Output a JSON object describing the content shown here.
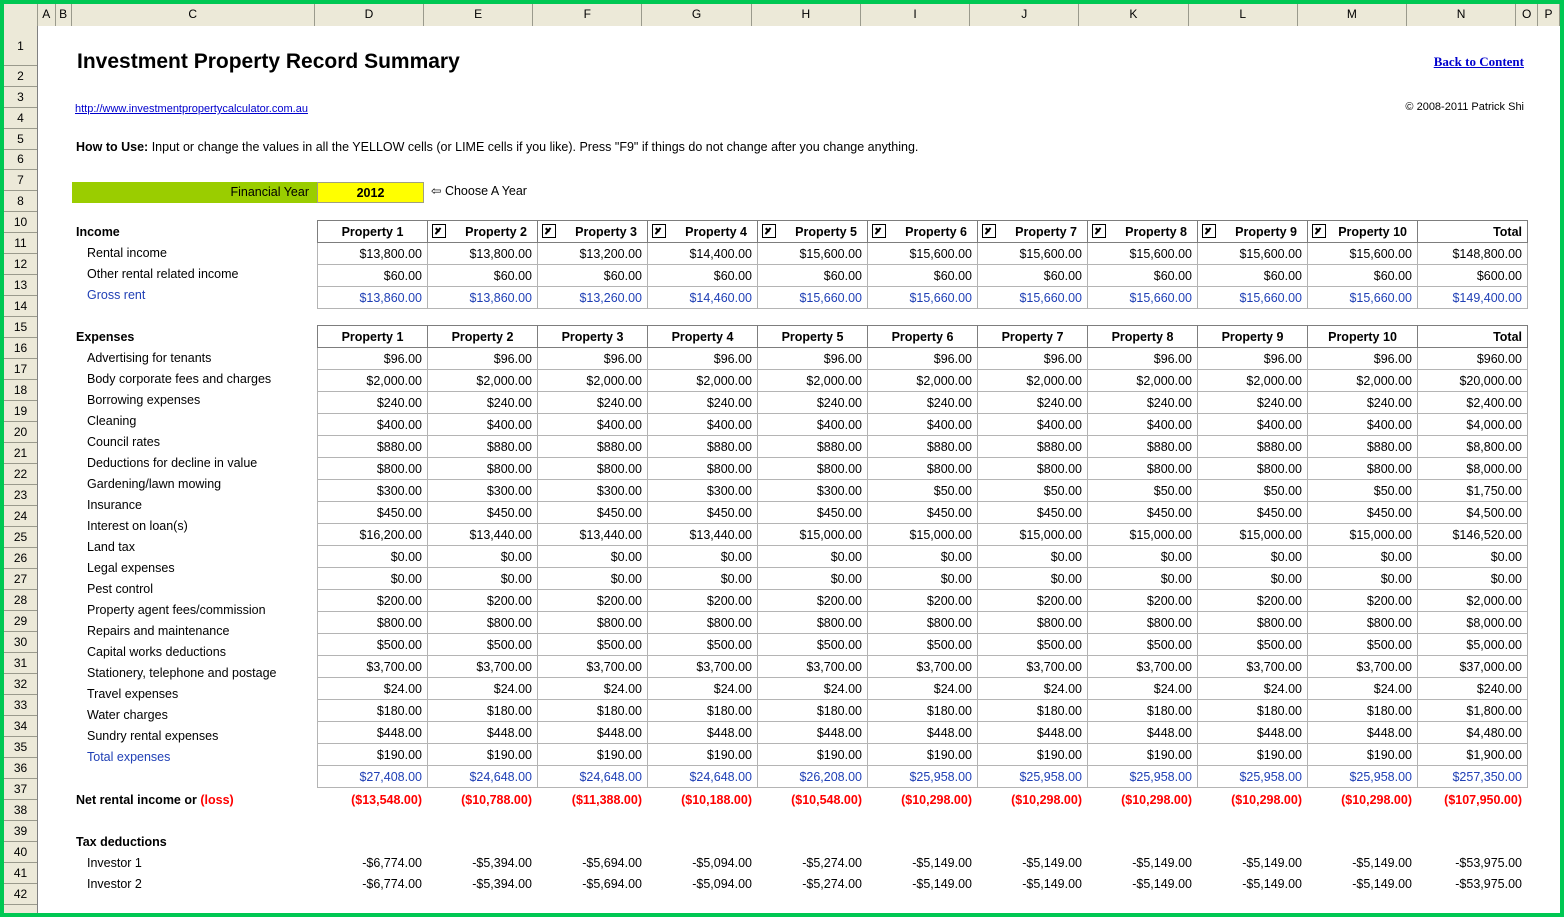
{
  "spreadsheet": {
    "column_headers": [
      "A",
      "B",
      "C",
      "D",
      "E",
      "F",
      "G",
      "H",
      "I",
      "J",
      "K",
      "L",
      "M",
      "N",
      "O",
      "P"
    ],
    "row_headers": [
      "1",
      "2",
      "3",
      "4",
      "5",
      "6",
      "7",
      "8",
      "10",
      "11",
      "12",
      "13",
      "14",
      "15",
      "16",
      "17",
      "18",
      "19",
      "20",
      "21",
      "22",
      "23",
      "24",
      "25",
      "26",
      "27",
      "28",
      "29",
      "30",
      "31",
      "32",
      "33",
      "34",
      "35",
      "36",
      "37",
      "38",
      "39",
      "40",
      "41",
      "42"
    ],
    "colors": {
      "selection_border": "#00c853",
      "header_bg": "#ece9d8",
      "lime": "#9acd00",
      "yellow": "#ffff00",
      "blue_text": "#1f3fb5",
      "link": "#0000cd",
      "red": "#ff0000"
    }
  },
  "header": {
    "title": "Investment Property Record Summary",
    "website_url": "http://www.investmentpropertycalculator.com.au",
    "back_to_content": "Back to Content",
    "copyright": "© 2008-2011 Patrick Shi",
    "howto_label": "How to Use:",
    "howto_text": " Input or change the values in all the YELLOW cells (or LIME cells if you like). Press \"F9\" if things do not change after you change anything.",
    "financial_year_label": "Financial Year",
    "financial_year_value": "2012",
    "choose_a_year": "⇦ Choose A Year"
  },
  "income": {
    "section_title": "Income",
    "columns": [
      "Property 1",
      "Property 2",
      "Property 3",
      "Property 4",
      "Property 5",
      "Property 6",
      "Property 7",
      "Property 8",
      "Property 9",
      "Property 10",
      "Total"
    ],
    "checkboxes": [
      false,
      true,
      true,
      true,
      true,
      true,
      true,
      true,
      true,
      true,
      false
    ],
    "rows": [
      {
        "label": "Rental income",
        "blue": false,
        "values": [
          "$13,800.00",
          "$13,800.00",
          "$13,200.00",
          "$14,400.00",
          "$15,600.00",
          "$15,600.00",
          "$15,600.00",
          "$15,600.00",
          "$15,600.00",
          "$15,600.00",
          "$148,800.00"
        ]
      },
      {
        "label": "Other rental related income",
        "blue": false,
        "values": [
          "$60.00",
          "$60.00",
          "$60.00",
          "$60.00",
          "$60.00",
          "$60.00",
          "$60.00",
          "$60.00",
          "$60.00",
          "$60.00",
          "$600.00"
        ]
      },
      {
        "label": "Gross rent",
        "blue": true,
        "values": [
          "$13,860.00",
          "$13,860.00",
          "$13,260.00",
          "$14,460.00",
          "$15,660.00",
          "$15,660.00",
          "$15,660.00",
          "$15,660.00",
          "$15,660.00",
          "$15,660.00",
          "$149,400.00"
        ]
      }
    ]
  },
  "expenses": {
    "section_title": "Expenses",
    "columns": [
      "Property 1",
      "Property 2",
      "Property 3",
      "Property 4",
      "Property 5",
      "Property 6",
      "Property 7",
      "Property 8",
      "Property 9",
      "Property 10",
      "Total"
    ],
    "rows": [
      {
        "label": "Advertising for tenants",
        "blue": false,
        "values": [
          "$96.00",
          "$96.00",
          "$96.00",
          "$96.00",
          "$96.00",
          "$96.00",
          "$96.00",
          "$96.00",
          "$96.00",
          "$96.00",
          "$960.00"
        ]
      },
      {
        "label": "Body corporate fees and charges",
        "blue": false,
        "values": [
          "$2,000.00",
          "$2,000.00",
          "$2,000.00",
          "$2,000.00",
          "$2,000.00",
          "$2,000.00",
          "$2,000.00",
          "$2,000.00",
          "$2,000.00",
          "$2,000.00",
          "$20,000.00"
        ]
      },
      {
        "label": "Borrowing expenses",
        "blue": false,
        "values": [
          "$240.00",
          "$240.00",
          "$240.00",
          "$240.00",
          "$240.00",
          "$240.00",
          "$240.00",
          "$240.00",
          "$240.00",
          "$240.00",
          "$2,400.00"
        ]
      },
      {
        "label": "Cleaning",
        "blue": false,
        "values": [
          "$400.00",
          "$400.00",
          "$400.00",
          "$400.00",
          "$400.00",
          "$400.00",
          "$400.00",
          "$400.00",
          "$400.00",
          "$400.00",
          "$4,000.00"
        ]
      },
      {
        "label": "Council rates",
        "blue": false,
        "values": [
          "$880.00",
          "$880.00",
          "$880.00",
          "$880.00",
          "$880.00",
          "$880.00",
          "$880.00",
          "$880.00",
          "$880.00",
          "$880.00",
          "$8,800.00"
        ]
      },
      {
        "label": "Deductions for decline in value",
        "blue": false,
        "values": [
          "$800.00",
          "$800.00",
          "$800.00",
          "$800.00",
          "$800.00",
          "$800.00",
          "$800.00",
          "$800.00",
          "$800.00",
          "$800.00",
          "$8,000.00"
        ]
      },
      {
        "label": "Gardening/lawn mowing",
        "blue": false,
        "values": [
          "$300.00",
          "$300.00",
          "$300.00",
          "$300.00",
          "$300.00",
          "$50.00",
          "$50.00",
          "$50.00",
          "$50.00",
          "$50.00",
          "$1,750.00"
        ]
      },
      {
        "label": "Insurance",
        "blue": false,
        "values": [
          "$450.00",
          "$450.00",
          "$450.00",
          "$450.00",
          "$450.00",
          "$450.00",
          "$450.00",
          "$450.00",
          "$450.00",
          "$450.00",
          "$4,500.00"
        ]
      },
      {
        "label": "Interest on loan(s)",
        "blue": false,
        "values": [
          "$16,200.00",
          "$13,440.00",
          "$13,440.00",
          "$13,440.00",
          "$15,000.00",
          "$15,000.00",
          "$15,000.00",
          "$15,000.00",
          "$15,000.00",
          "$15,000.00",
          "$146,520.00"
        ]
      },
      {
        "label": "Land tax",
        "blue": false,
        "values": [
          "$0.00",
          "$0.00",
          "$0.00",
          "$0.00",
          "$0.00",
          "$0.00",
          "$0.00",
          "$0.00",
          "$0.00",
          "$0.00",
          "$0.00"
        ]
      },
      {
        "label": "Legal expenses",
        "blue": false,
        "values": [
          "$0.00",
          "$0.00",
          "$0.00",
          "$0.00",
          "$0.00",
          "$0.00",
          "$0.00",
          "$0.00",
          "$0.00",
          "$0.00",
          "$0.00"
        ]
      },
      {
        "label": "Pest control",
        "blue": false,
        "values": [
          "$200.00",
          "$200.00",
          "$200.00",
          "$200.00",
          "$200.00",
          "$200.00",
          "$200.00",
          "$200.00",
          "$200.00",
          "$200.00",
          "$2,000.00"
        ]
      },
      {
        "label": "Property agent fees/commission",
        "blue": false,
        "values": [
          "$800.00",
          "$800.00",
          "$800.00",
          "$800.00",
          "$800.00",
          "$800.00",
          "$800.00",
          "$800.00",
          "$800.00",
          "$800.00",
          "$8,000.00"
        ]
      },
      {
        "label": "Repairs and maintenance",
        "blue": false,
        "values": [
          "$500.00",
          "$500.00",
          "$500.00",
          "$500.00",
          "$500.00",
          "$500.00",
          "$500.00",
          "$500.00",
          "$500.00",
          "$500.00",
          "$5,000.00"
        ]
      },
      {
        "label": "Capital works deductions",
        "blue": false,
        "values": [
          "$3,700.00",
          "$3,700.00",
          "$3,700.00",
          "$3,700.00",
          "$3,700.00",
          "$3,700.00",
          "$3,700.00",
          "$3,700.00",
          "$3,700.00",
          "$3,700.00",
          "$37,000.00"
        ]
      },
      {
        "label": "Stationery, telephone and postage",
        "blue": false,
        "values": [
          "$24.00",
          "$24.00",
          "$24.00",
          "$24.00",
          "$24.00",
          "$24.00",
          "$24.00",
          "$24.00",
          "$24.00",
          "$24.00",
          "$240.00"
        ]
      },
      {
        "label": "Travel expenses",
        "blue": false,
        "values": [
          "$180.00",
          "$180.00",
          "$180.00",
          "$180.00",
          "$180.00",
          "$180.00",
          "$180.00",
          "$180.00",
          "$180.00",
          "$180.00",
          "$1,800.00"
        ]
      },
      {
        "label": "Water charges",
        "blue": false,
        "values": [
          "$448.00",
          "$448.00",
          "$448.00",
          "$448.00",
          "$448.00",
          "$448.00",
          "$448.00",
          "$448.00",
          "$448.00",
          "$448.00",
          "$4,480.00"
        ]
      },
      {
        "label": "Sundry rental expenses",
        "blue": false,
        "values": [
          "$190.00",
          "$190.00",
          "$190.00",
          "$190.00",
          "$190.00",
          "$190.00",
          "$190.00",
          "$190.00",
          "$190.00",
          "$190.00",
          "$1,900.00"
        ]
      },
      {
        "label": "Total expenses",
        "blue": true,
        "values": [
          "$27,408.00",
          "$24,648.00",
          "$24,648.00",
          "$24,648.00",
          "$26,208.00",
          "$25,958.00",
          "$25,958.00",
          "$25,958.00",
          "$25,958.00",
          "$25,958.00",
          "$257,350.00"
        ]
      }
    ]
  },
  "net_rental": {
    "label_main": "Net rental income or ",
    "label_loss": "(loss)",
    "values": [
      "($13,548.00)",
      "($10,788.00)",
      "($11,388.00)",
      "($10,188.00)",
      "($10,548.00)",
      "($10,298.00)",
      "($10,298.00)",
      "($10,298.00)",
      "($10,298.00)",
      "($10,298.00)",
      "($107,950.00)"
    ]
  },
  "tax_deductions": {
    "section_title": "Tax deductions",
    "rows": [
      {
        "label": "Investor 1",
        "values": [
          "-$6,774.00",
          "-$5,394.00",
          "-$5,694.00",
          "-$5,094.00",
          "-$5,274.00",
          "-$5,149.00",
          "-$5,149.00",
          "-$5,149.00",
          "-$5,149.00",
          "-$5,149.00",
          "-$53,975.00"
        ]
      },
      {
        "label": "Investor 2",
        "values": [
          "-$6,774.00",
          "-$5,394.00",
          "-$5,694.00",
          "-$5,094.00",
          "-$5,274.00",
          "-$5,149.00",
          "-$5,149.00",
          "-$5,149.00",
          "-$5,149.00",
          "-$5,149.00",
          "-$53,975.00"
        ]
      }
    ]
  }
}
